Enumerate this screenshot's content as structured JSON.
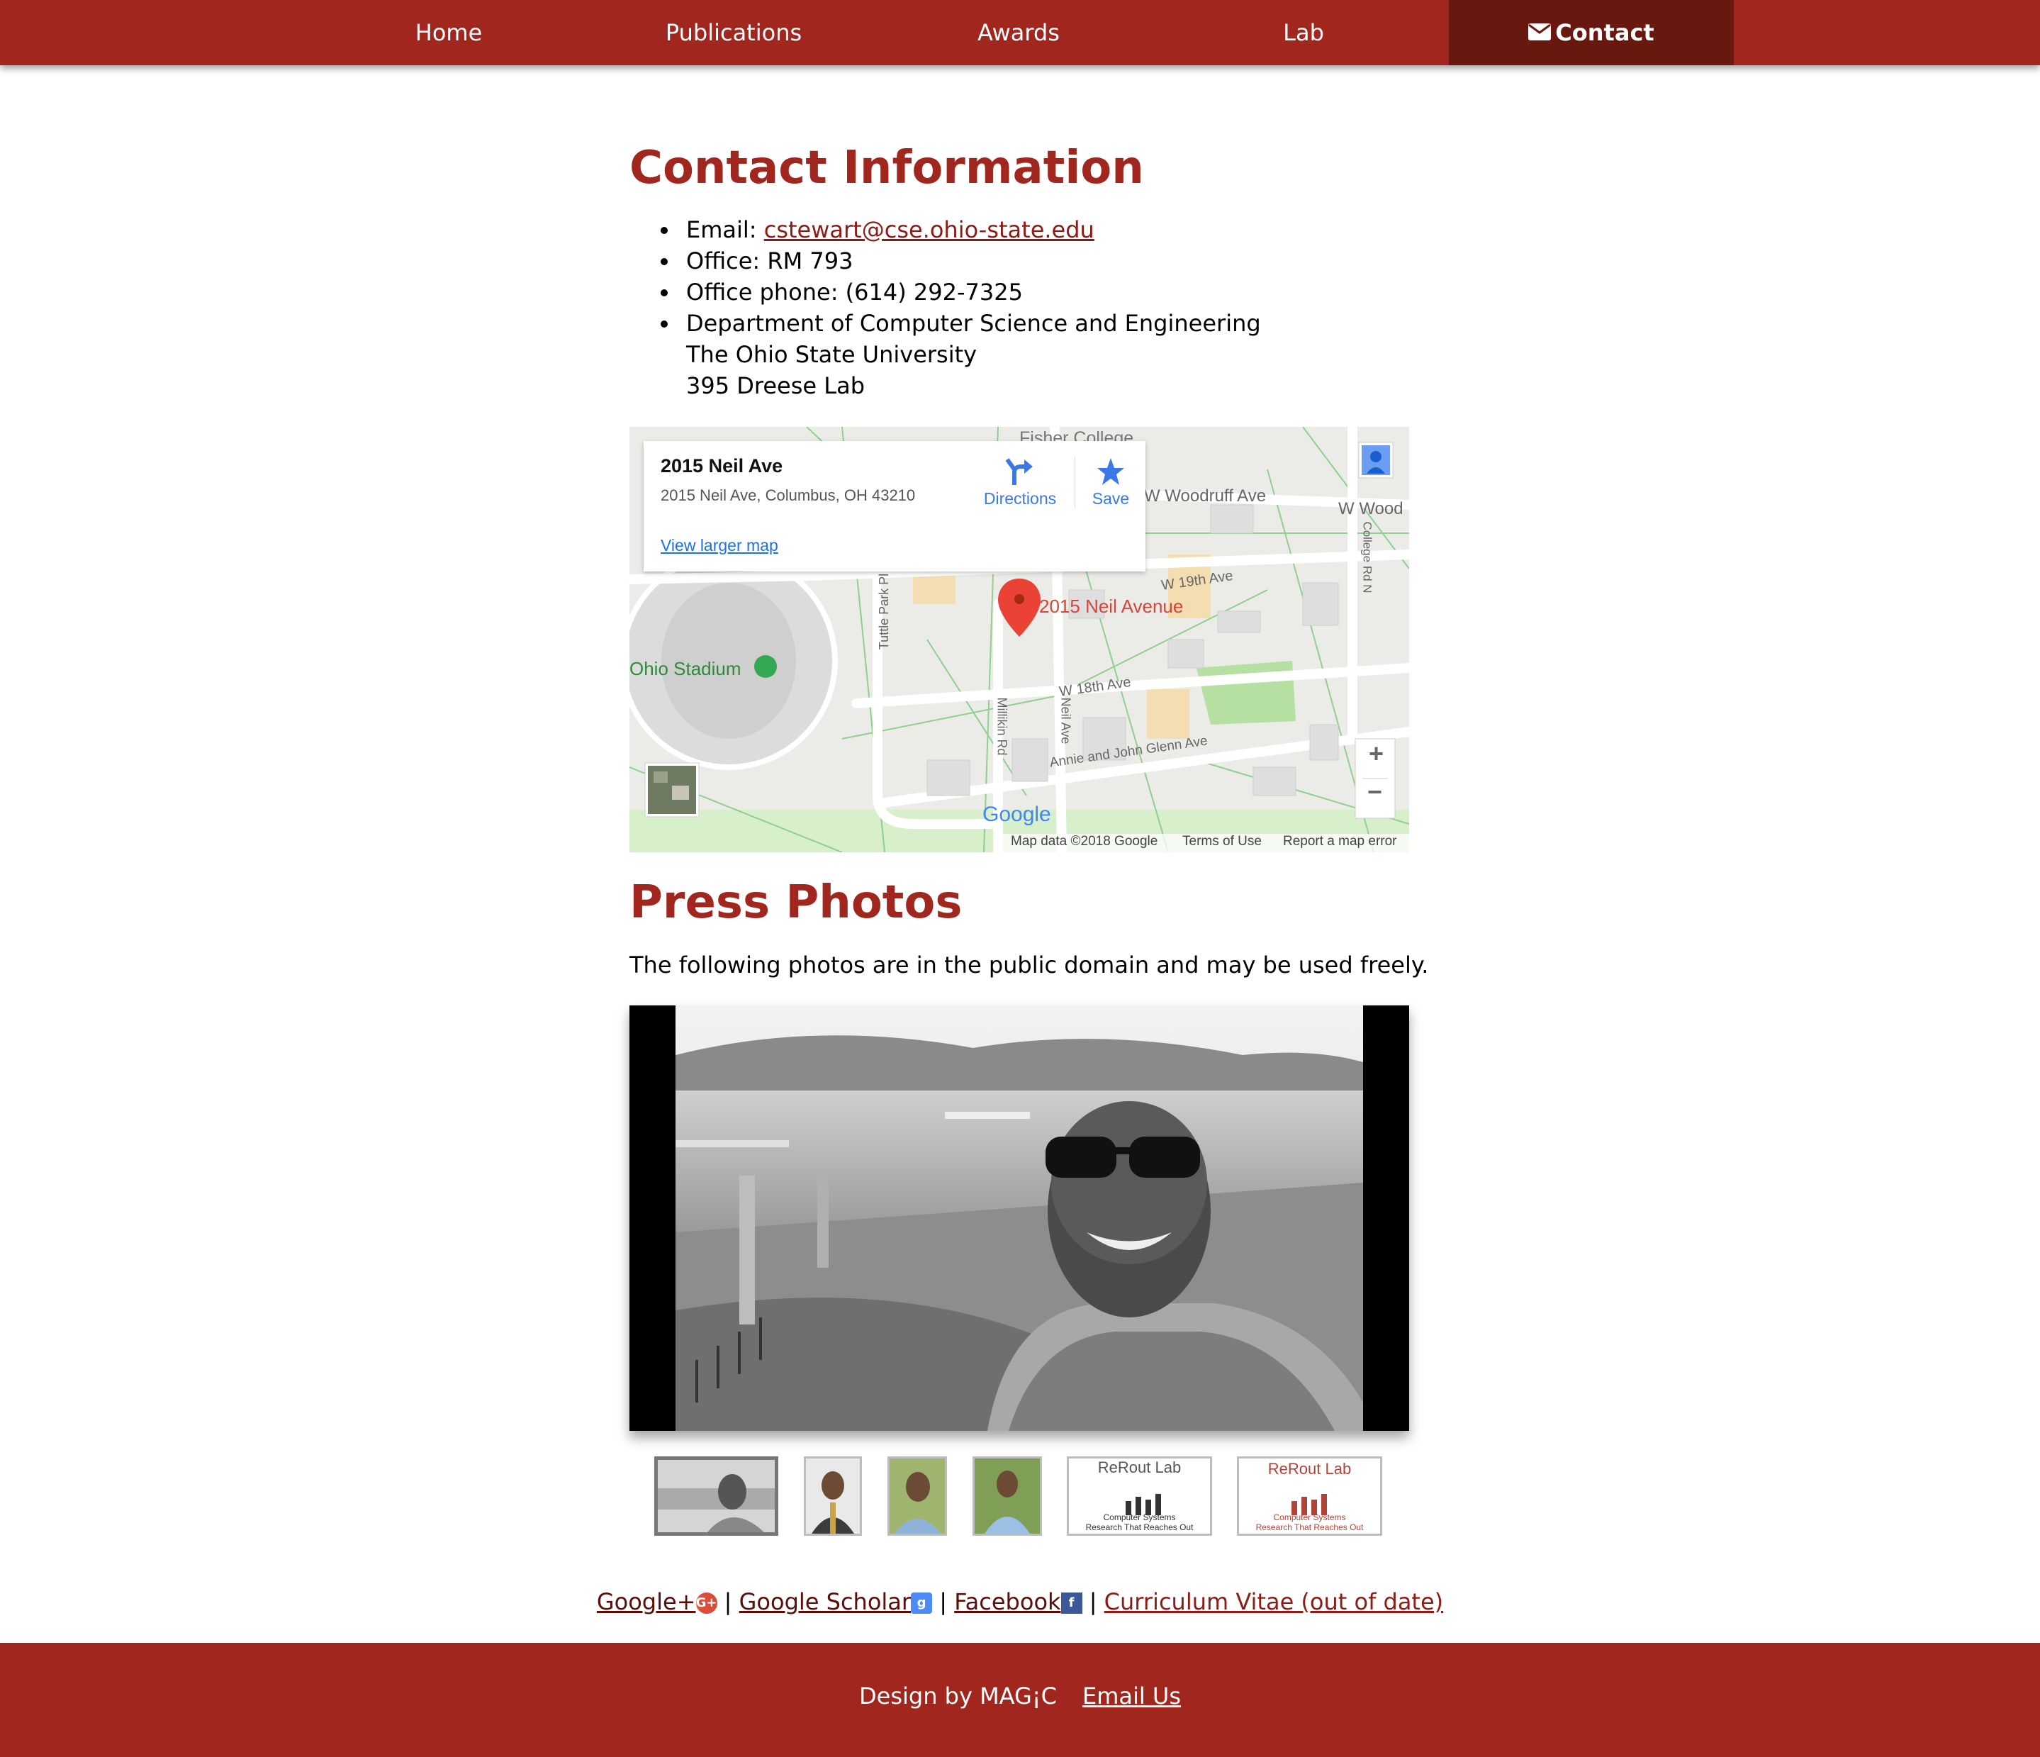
{
  "nav": {
    "items": [
      {
        "label": "Home"
      },
      {
        "label": "Publications"
      },
      {
        "label": "Awards"
      },
      {
        "label": "Lab"
      },
      {
        "label": "Contact",
        "icon": "envelope-icon",
        "active": true
      }
    ]
  },
  "contact": {
    "heading": "Contact Information",
    "email_label": "Email: ",
    "email": "cstewart@cse.ohio-state.edu",
    "office": "Office: RM 793",
    "phone": "Office phone: (614) 292-7325",
    "address_lines": [
      "Department of Computer Science and Engineering",
      "The Ohio State University",
      "395 Dreese Lab"
    ]
  },
  "map": {
    "place_title": "2015 Neil Ave",
    "place_address": "2015 Neil Ave, Columbus, OH 43210",
    "directions_label": "Directions",
    "save_label": "Save",
    "larger_map_label": "View larger map",
    "pin_label": "2015 Neil Avenue",
    "labels": {
      "stadium": "Ohio Stadium",
      "woodruff": "W Woodruff Ave",
      "w_wood": "W Wood",
      "fisher": "Fisher College",
      "w19": "W 19th Ave",
      "w18": "W 18th Ave",
      "annie": "Annie and John Glenn Ave",
      "millikin": "Millikin Rd",
      "neil": "Neil Ave",
      "tuttle": "Tuttle Park Pl",
      "college": "College Rd N"
    },
    "google_logo": "Google",
    "attribution": "Map data ©2018 Google",
    "terms": "Terms of Use",
    "report": "Report a map error",
    "zoom_in": "+",
    "zoom_out": "−"
  },
  "press": {
    "heading": "Press Photos",
    "intro": "The following photos are in the public domain and may be used freely.",
    "thumb_lab_title": "ReRout Lab",
    "thumb_lab_sub1": "Computer Systems",
    "thumb_lab_sub2": "Research That Reaches Out"
  },
  "links": {
    "google_plus": "Google+",
    "google_scholar": "Google Scholar",
    "facebook": "Facebook",
    "cv": "Curriculum Vitae (out of date)",
    "sep": "|"
  },
  "footer": {
    "design": "Design by MAG¡C",
    "email_us": "Email Us"
  },
  "colors": {
    "brand": "#a0261e",
    "nav_active": "#691810",
    "link": "#8b1d16",
    "map_blue": "#3b78e7"
  }
}
